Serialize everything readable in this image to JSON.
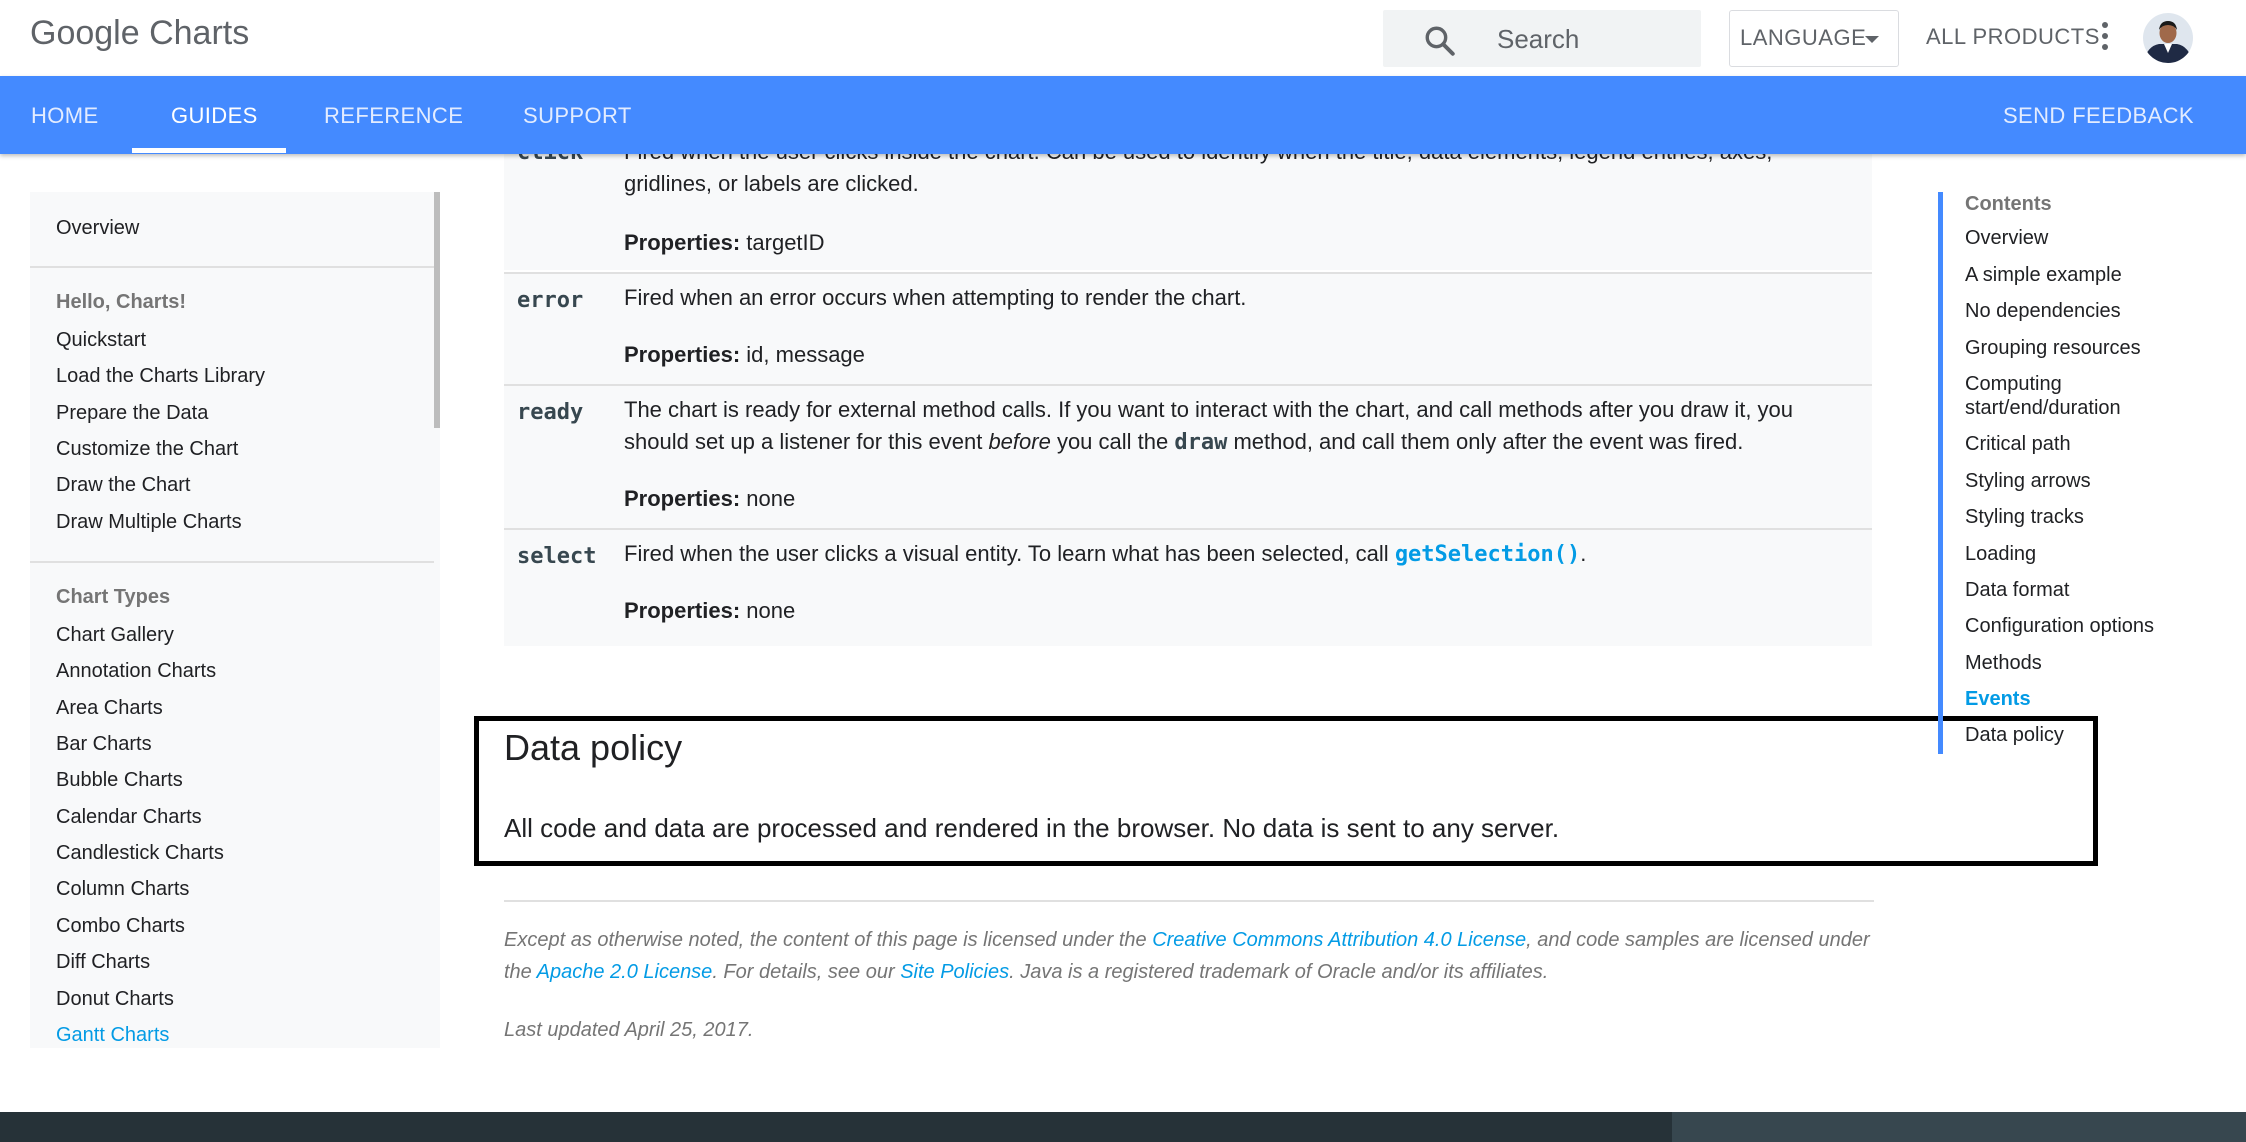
{
  "header": {
    "logo": "Google Charts",
    "search_placeholder": "Search",
    "language_label": "LANGUAGE",
    "all_products_label": "ALL PRODUCTS"
  },
  "nav": {
    "tabs": [
      {
        "label": "HOME"
      },
      {
        "label": "GUIDES",
        "active": true
      },
      {
        "label": "REFERENCE"
      },
      {
        "label": "SUPPORT"
      }
    ],
    "feedback_label": "SEND FEEDBACK",
    "bar_color": "#448aff"
  },
  "sidebar": {
    "overview": "Overview",
    "section1": {
      "heading": "Hello, Charts!",
      "items": [
        "Quickstart",
        "Load the Charts Library",
        "Prepare the Data",
        "Customize the Chart",
        "Draw the Chart",
        "Draw Multiple Charts"
      ]
    },
    "section2": {
      "heading": "Chart Types",
      "items": [
        "Chart Gallery",
        "Annotation Charts",
        "Area Charts",
        "Bar Charts",
        "Bubble Charts",
        "Calendar Charts",
        "Candlestick Charts",
        "Column Charts",
        "Combo Charts",
        "Diff Charts",
        "Donut Charts",
        "Gantt Charts"
      ],
      "active": "Gantt Charts"
    }
  },
  "events": {
    "click": {
      "name": "click",
      "desc": "Fired when the user clicks inside the chart. Can be used to identify when the title, data elements, legend entries, axes, gridlines, or labels are clicked.",
      "props_label": "Properties:",
      "props": "targetID"
    },
    "error": {
      "name": "error",
      "desc": "Fired when an error occurs when attempting to render the chart.",
      "props_label": "Properties:",
      "props": "id, message"
    },
    "ready": {
      "name": "ready",
      "desc_1": "The chart is ready for external method calls. If you want to interact with the chart, and call methods after you draw it, you should set up a listener for this event ",
      "desc_em": "before",
      "desc_2": " you call the ",
      "desc_code": "draw",
      "desc_3": " method, and call them only after the event was fired.",
      "props_label": "Properties:",
      "props": "none"
    },
    "select": {
      "name": "select",
      "desc_1": "Fired when the user clicks a visual entity. To learn what has been selected, call ",
      "desc_link": "getSelection()",
      "desc_2": ".",
      "props_label": "Properties:",
      "props": "none"
    }
  },
  "data_policy": {
    "title": "Data policy",
    "text": "All code and data are processed and rendered in the browser. No data is sent to any server."
  },
  "license": {
    "t1": "Except as otherwise noted, the content of this page is licensed under the ",
    "link1": "Creative Commons Attribution 4.0 License",
    "t2": ", and code samples are licensed under the ",
    "link2": "Apache 2.0 License",
    "t3": ". For details, see our ",
    "link3": "Site Policies",
    "t4": ". Java is a registered trademark of Oracle and/or its affiliates."
  },
  "last_updated": "Last updated April 25, 2017.",
  "toc": {
    "heading": "Contents",
    "items": [
      "Overview",
      "A simple example",
      "No dependencies",
      "Grouping resources",
      "Computing start/end/duration",
      "Critical path",
      "Styling arrows",
      "Styling tracks",
      "Loading",
      "Data format",
      "Configuration options",
      "Methods",
      "Events",
      "Data policy"
    ],
    "active": "Events"
  }
}
